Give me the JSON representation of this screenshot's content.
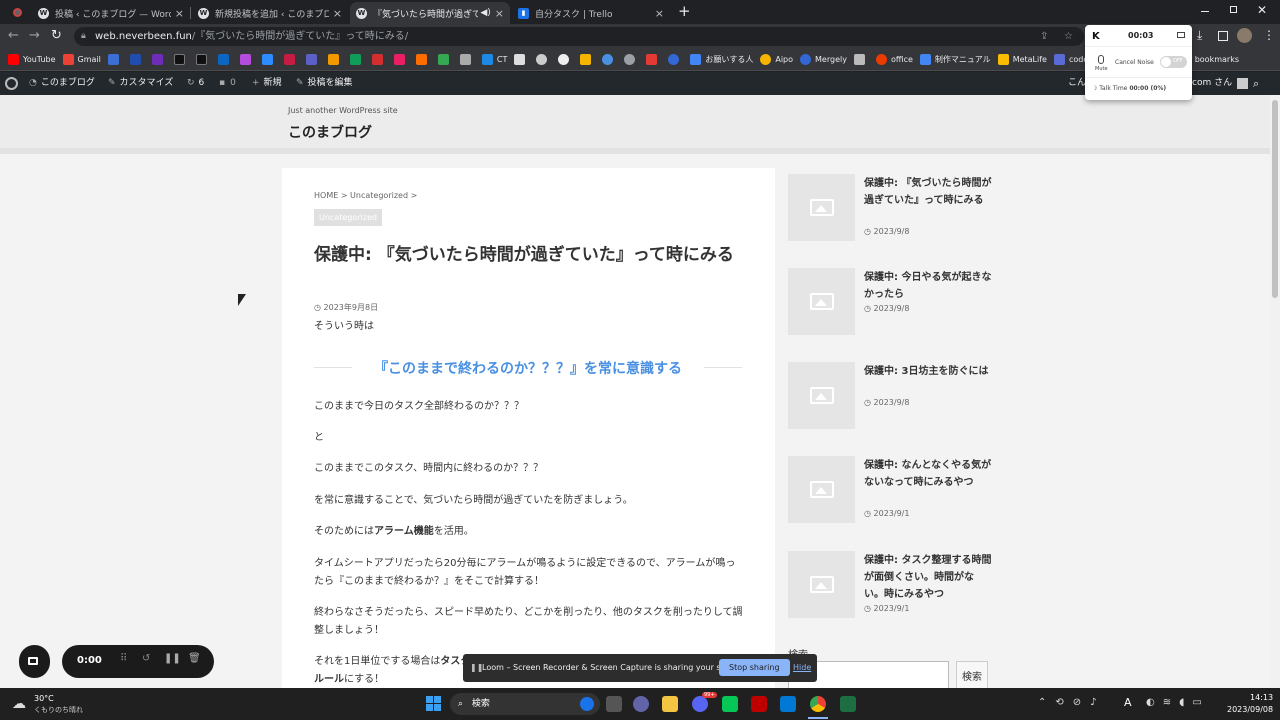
{
  "tabs": [
    {
      "title": "投稿 ‹ このまブログ — WordPress"
    },
    {
      "title": "新規投稿を追加 ‹ このまブログ — W"
    },
    {
      "title": "『気づいたら時間が過ぎていた』"
    },
    {
      "title": "自分タスク | Trello"
    }
  ],
  "new_tab": "+",
  "url": {
    "host": "web.neverbeen.fun",
    "path": "/『気づいたら時間が過ぎていた』って時にみる/"
  },
  "bookmarks": [
    {
      "label": "YouTube",
      "color": "#ff0000"
    },
    {
      "label": "Gmail",
      "color": "#ea4335"
    },
    {
      "label": "",
      "color": "#3b6fd6"
    },
    {
      "label": "",
      "color": "#1f4db0"
    },
    {
      "label": "",
      "color": "#6d2db8"
    },
    {
      "label": "",
      "color": "#111111"
    },
    {
      "label": "",
      "color": "#111111"
    },
    {
      "label": "",
      "color": "#0a66c2"
    },
    {
      "label": "",
      "color": "#b44ddb"
    },
    {
      "label": "",
      "color": "#2d8cff"
    },
    {
      "label": "",
      "color": "#c51b44"
    },
    {
      "label": "",
      "color": "#5b5fc7"
    },
    {
      "label": "",
      "color": "#f29900"
    },
    {
      "label": "",
      "color": "#0f9d58"
    },
    {
      "label": "",
      "color": "#d32f2f"
    },
    {
      "label": "",
      "color": "#e91e63"
    },
    {
      "label": "",
      "color": "#ff6d00"
    },
    {
      "label": "",
      "color": "#34a853"
    },
    {
      "label": "",
      "color": "#aaaaaa"
    },
    {
      "label": "CT",
      "color": "#1e88e5"
    },
    {
      "label": "お願いする人",
      "color": "#4285f4"
    },
    {
      "label": "Aipo",
      "color": "#f4b400"
    },
    {
      "label": "Mergely",
      "color": "#3367d6"
    },
    {
      "label": "office",
      "color": "#eb3c00"
    },
    {
      "label": "制作マニュアル",
      "color": "#4285f4"
    },
    {
      "label": "MetaLife",
      "color": "#fbbc04"
    },
    {
      "label": "codo-life",
      "color": "#5b6bd6"
    },
    {
      "label": "Other bookmarks",
      "color": "#f4c542"
    }
  ],
  "adminbar": {
    "site": "このまブログ",
    "customize": "カスタマイズ",
    "updates": "6",
    "comments": "0",
    "new": "新規",
    "edit": "投稿を編集",
    "howdy": "こん",
    "user_suffix": "com さん"
  },
  "site": {
    "tagline": "Just another WordPress site",
    "title": "このまブログ"
  },
  "article": {
    "breadcrumb": "HOME > Uncategorized >",
    "category": "Uncategorized",
    "title": "保護中: 『気づいたら時間が過ぎていた』って時にみる",
    "date": "2023年9月8日",
    "intro": "そういう時は",
    "heading": "『このままで終わるのか？？？』を常に意識する",
    "p1": "このままで今日のタスク全部終わるのか？？？",
    "p2": "と",
    "p3": "このままでこのタスク、時間内に終わるのか？？？",
    "p4": "を常に意識することで、気づいたら時間が過ぎていたを防ぎましょう。",
    "p5_pre": "そのためには",
    "p5_bold": "アラーム機能",
    "p5_post": "を活用。",
    "p6": "タイムシートアプリだったら20分毎にアラームが鳴るように設定できるので、アラームが鳴ったら『このままで終わるか？』をそこで計算する！",
    "p7": "終わらなさそうだったら、スピード早めたり、どこかを削ったり、他のタスクを削ったりして調整しましょう！",
    "p8_pre": "それを1日単位でする場合は",
    "p8_bold": "タスク",
    "p9_bold": "ルール",
    "p9_post": "にする！"
  },
  "sidebar": {
    "posts": [
      {
        "title": "保護中: 『気づいたら時間が過ぎていた』って時にみる",
        "date": "2023/9/8"
      },
      {
        "title": "保護中: 今日やる気が起きなかったら",
        "date": "2023/9/8"
      },
      {
        "title": "保護中: 3日坊主を防ぐには",
        "date": "2023/9/8"
      },
      {
        "title": "保護中: なんとなくやる気がないなって時にみるやつ",
        "date": "2023/9/1"
      },
      {
        "title": "保護中: タスク整理する時間が面倒くさい。時間がない。時にみるやつ",
        "date": "2023/9/1"
      }
    ],
    "search_label": "検索",
    "search_button": "検索"
  },
  "krisp": {
    "time": "00:03",
    "mute": "Mute",
    "cancel_noise": "Cancel Noise",
    "toggle": "OFF",
    "talk_time": "Talk Time",
    "talk_value": "00:00 (0%)"
  },
  "loom": {
    "message": "Loom – Screen Recorder & Screen Capture is sharing your screen.",
    "stop": "Stop sharing",
    "hide": "Hide",
    "timer": "0:00"
  },
  "taskbar": {
    "temp": "30°C",
    "weather": "くもりのち晴れ",
    "search": "検索",
    "time": "14:13",
    "date": "2023/09/08",
    "badge": "99+",
    "lang": "A"
  }
}
